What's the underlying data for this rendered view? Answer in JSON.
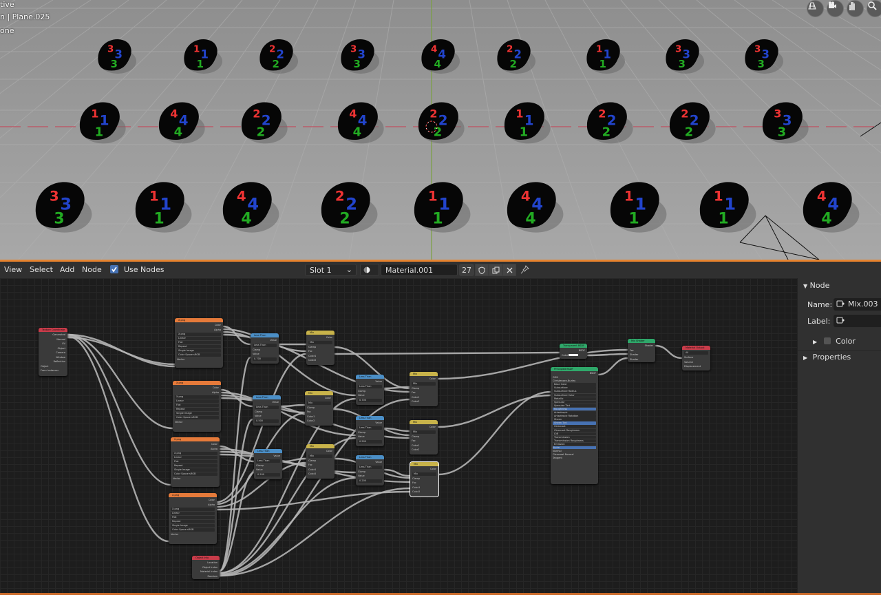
{
  "viewport": {
    "mode_text": "tive",
    "object_text": "n | Plane.025",
    "extra_text": "one",
    "nav_icons": [
      "grid-icon",
      "camera-icon",
      "hand-icon",
      "zoom-icon"
    ],
    "digit_rows": [
      [
        "3",
        "1",
        "2",
        "3",
        "4",
        "2",
        "1",
        "3",
        "3"
      ],
      [
        "1",
        "4",
        "2",
        "4",
        "2",
        "1",
        "2",
        "2",
        "3"
      ],
      [
        "3",
        "1",
        "4",
        "2",
        "1",
        "4",
        "1",
        "1",
        "4"
      ]
    ]
  },
  "header": {
    "menus": [
      "View",
      "Select",
      "Add",
      "Node"
    ],
    "use_nodes_label": "Use Nodes",
    "slot": "Slot 1",
    "material": "Material.001",
    "users": "27"
  },
  "sidebar": {
    "tab_title": "Node",
    "name_label": "Name:",
    "name_value": "Mix.003",
    "label_label": "Label:",
    "color_label": "Color",
    "properties_label": "Properties"
  },
  "nodes": {
    "texcoord": {
      "title": "Texture Coordinate",
      "outs": [
        "Generated",
        "Normal",
        "UV",
        "Object",
        "Camera",
        "Window",
        "Reflection"
      ],
      "object": "Object",
      "from": "From Instancer"
    },
    "image": {
      "title": "X.png",
      "outs": [
        "Color",
        "Alpha"
      ],
      "file": "X.png",
      "opts": [
        "Linear",
        "Flat",
        "Repeat",
        "Single Image",
        "Color Space",
        "Vector"
      ],
      "cs": "sRGB"
    },
    "lessthan": {
      "title": "Less Than",
      "out": "Value",
      "op": "Less Than",
      "clamp": "Clamp",
      "v": "Value",
      "thr": "0.700",
      "thr2": "0.500",
      "thr3": "0.200"
    },
    "mix": {
      "title": "Mix",
      "out": "Color",
      "mode": "Mix",
      "clamp": "Clamp",
      "fac": "Fac",
      "c1": "Color1",
      "c2": "Color2"
    },
    "objinfo": {
      "title": "Object Info",
      "outs": [
        "Location",
        "Object Index",
        "Material Index",
        "Random"
      ]
    },
    "bsdf_small": {
      "title": "Transparent BSDF",
      "out": "BSDF",
      "color": "Color"
    },
    "mixshader": {
      "title": "Mix Shader",
      "out": "Shader",
      "ins": [
        "Fac",
        "Shader",
        "Shader"
      ]
    },
    "output": {
      "title": "Material Output",
      "sel": "All",
      "ins": [
        "Surface",
        "Volume",
        "Displacement"
      ]
    },
    "principled": {
      "title": "Principled BSDF",
      "out": "BSDF",
      "rows": [
        "GGX",
        "Christensen-Burley",
        "Base Color",
        "Subsurface",
        "Subsurface Radius",
        "Subsurface Color",
        "Metallic",
        "Specular",
        "Specular Tint",
        "Roughness",
        "Anisotropic",
        "Anisotropic Rotation",
        "Sheen",
        "Sheen Tint",
        "Clearcoat",
        "Clearcoat Roughness",
        "IOR",
        "Transmission",
        "Transmission Roughness",
        "Emission",
        "Alpha",
        "Normal",
        "Clearcoat Normal",
        "Tangent"
      ]
    }
  }
}
